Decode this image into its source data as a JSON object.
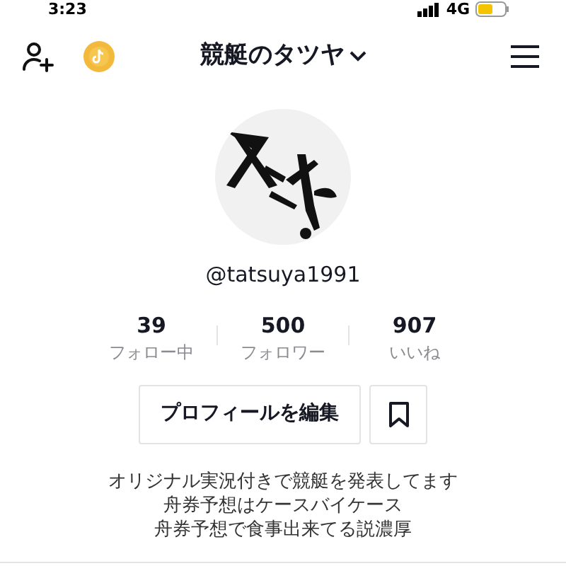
{
  "status_bar": {
    "time": "3:23",
    "network": "4G"
  },
  "header": {
    "title": "競艇のタツヤ"
  },
  "profile": {
    "username": "@tatsuya1991"
  },
  "stats": [
    {
      "value": "39",
      "label": "フォロー中"
    },
    {
      "value": "500",
      "label": "フォロワー"
    },
    {
      "value": "907",
      "label": "いいね"
    }
  ],
  "buttons": {
    "edit_profile": "プロフィールを編集"
  },
  "bio": [
    "オリジナル実況付きで競艇を発表してます",
    "舟券予想はケースバイケース",
    "舟券予想で食事出来てる説濃厚"
  ]
}
